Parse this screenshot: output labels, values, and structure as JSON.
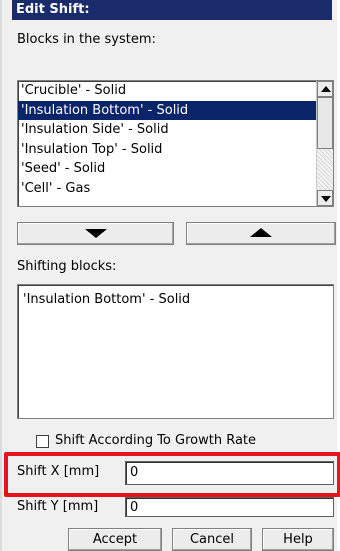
{
  "dialog": {
    "title": "Edit Shift:",
    "blocks_label": "Blocks in the system:",
    "blocks": [
      "'Crucible' - Solid",
      "'Insulation Bottom' - Solid",
      "'Insulation Side' - Solid",
      "'Insulation Top' - Solid",
      "'Seed' - Solid",
      "'Cell' - Gas"
    ],
    "selected_block": "'Insulation Bottom' - Solid",
    "shifting_label": "Shifting blocks:",
    "shifting_blocks": [
      "'Insulation Bottom' - Solid"
    ],
    "growth_rate_label": "Shift According To Growth Rate",
    "growth_rate_checked": false,
    "shift_x_label": "Shift X [mm]",
    "shift_x_value": "0",
    "shift_y_label": "Shift Y [mm]",
    "shift_y_value": "0",
    "accept_label": "Accept",
    "cancel_label": "Cancel",
    "help_label": "Help",
    "highlight_color": "#e8141c",
    "selection_color": "#0a246a",
    "titlebar_color": "#1a2b6b"
  }
}
